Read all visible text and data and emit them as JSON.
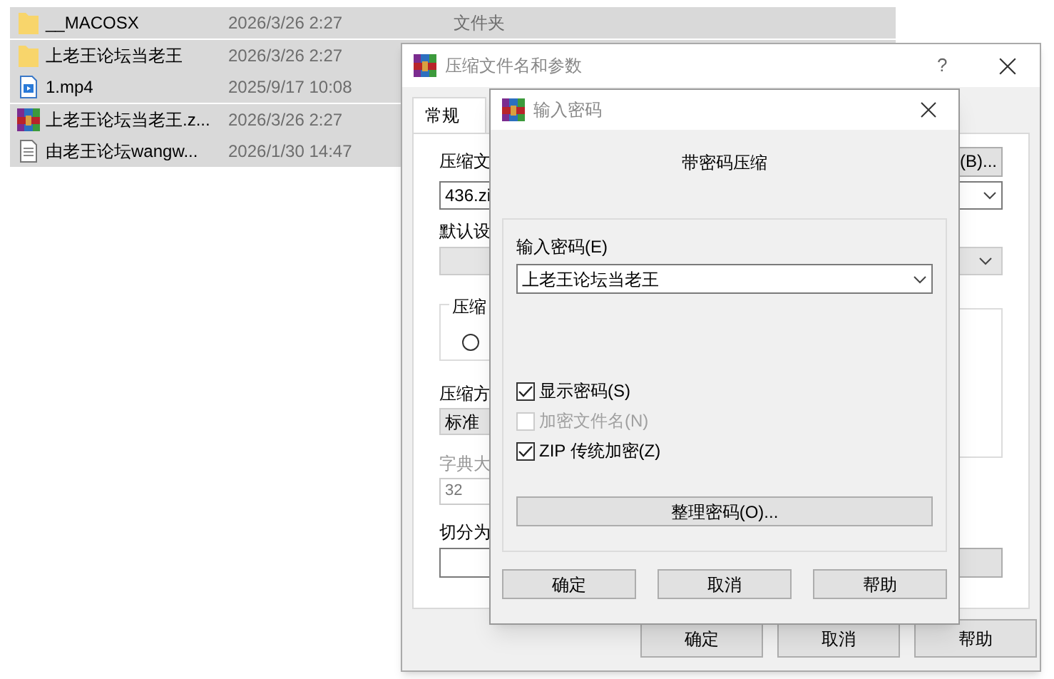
{
  "file_list": {
    "rows": [
      {
        "kind": "folder",
        "name": "__MACOSX",
        "date": "2026/3/26 2:27",
        "type": "文件夹",
        "selected": true
      },
      {
        "kind": "folder",
        "name": "上老王论坛当老王",
        "date": "2026/3/26 2:27",
        "selected": true
      },
      {
        "kind": "video",
        "name": "1.mp4",
        "date": "2025/9/17 10:08",
        "selected": true
      },
      {
        "kind": "archive",
        "name": "上老王论坛当老王.z...",
        "date": "2026/3/26 2:27",
        "selected": true
      },
      {
        "kind": "text",
        "name": "由老王论坛wangw...",
        "date": "2026/1/30 14:47",
        "selected": true
      }
    ]
  },
  "archive_dialog": {
    "title": "压缩文件名和参数",
    "help": "?",
    "tabs": [
      {
        "label": "常规",
        "selected": true
      }
    ],
    "archive_name_label": "压缩文",
    "browse_button": "(B)...",
    "archive_name": "436.zi",
    "profile_label": "默认设",
    "group_label": "压缩",
    "radio": {
      "selected": false
    },
    "method_label": "压缩方",
    "method": "标准",
    "dictionary_label": "字典大",
    "dictionary": "32",
    "split_label": "切分为",
    "buttons": [
      "确定",
      "取消",
      "帮助"
    ]
  },
  "password_dialog": {
    "title": "输入密码",
    "heading": "带密码压缩",
    "password_label": "输入密码(E)",
    "password": "上老王论坛当老王",
    "options": [
      {
        "label": "显示密码(S)",
        "checked": true,
        "disabled": false
      },
      {
        "label": "加密文件名(N)",
        "checked": false,
        "disabled": true
      },
      {
        "label": "ZIP 传统加密(Z)",
        "checked": true,
        "disabled": false
      }
    ],
    "organize_button": "整理密码(O)...",
    "buttons": [
      "确定",
      "取消",
      "帮助"
    ]
  }
}
